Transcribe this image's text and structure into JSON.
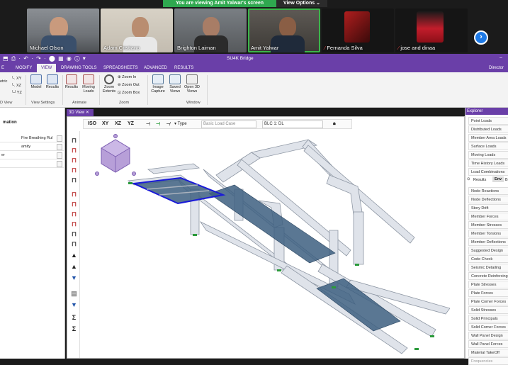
{
  "zoom": {
    "share_notice": "You are viewing Amit Yalwar's screen",
    "view_options": "View Options ⌄"
  },
  "participants": [
    {
      "name": "Michael Olson"
    },
    {
      "name": "Adam Cristiano"
    },
    {
      "name": "Brighton Laiman"
    },
    {
      "name": "Amit Yalwar"
    },
    {
      "name": "Fernanda Silva"
    },
    {
      "name": "jose and dinaa"
    }
  ],
  "app": {
    "title": "SU4K Bridge",
    "user": "Director"
  },
  "ribbon_tabs": [
    "MODIFY",
    "VIEW",
    "DRAWING TOOLS",
    "SPREADSHEETS",
    "ADVANCED",
    "RESULTS"
  ],
  "ribbon": {
    "view_settings": {
      "model": "Model",
      "results": "Results",
      "group": "View Settings",
      "xy": "XY",
      "xz": "XZ",
      "yz": "YZ",
      "etric": "etric",
      "d_view": "D View"
    },
    "animate": {
      "results": "Results",
      "moving_loads": "Moving Loads",
      "group": "Animate"
    },
    "zoom": {
      "extents": "Zoom Extents",
      "in": "Zoom In",
      "out": "Zoom Out",
      "box": "Zoom Box",
      "group": "Zoom"
    },
    "window": {
      "image_capture": "Image Capture",
      "saved_views": "Saved Views",
      "open_3d": "Open 3D Views",
      "group": "Window"
    }
  },
  "left_panel": {
    "header": "mation",
    "rows": [
      {
        "label": "",
        "value": "Fire Breathing Rul"
      },
      {
        "label": "",
        "value": "amity"
      },
      {
        "label": "er",
        "value": ""
      },
      {
        "label": "",
        "value": ""
      }
    ]
  },
  "view": {
    "tab": "3D View",
    "toolbar": {
      "iso": "ISO",
      "xy": "XY",
      "xz": "XZ",
      "yz": "YZ",
      "type": "Type",
      "load_case": "Basic Load Case",
      "case_value": "BLC 1: DL"
    }
  },
  "explorer": {
    "title": "Explorer",
    "items_top": [
      "Point Loads",
      "Distributed Loads",
      "Member Area Loads",
      "Surface Loads",
      "Moving Loads",
      "Time History Loads",
      "Load Combinations"
    ],
    "tabs": {
      "results": "Results",
      "env": "Env",
      "b": "B"
    },
    "items_bottom": [
      "Node Reactions",
      "Node Deflections",
      "Story Drift",
      "Member Forces",
      "Member Stresses",
      "Member Torsions",
      "Member Deflections",
      "Suggested Design",
      "Code Check",
      "Seismic Detailing",
      "Concrete Reinforcing",
      "Plate Stresses",
      "Plate Forces",
      "Plate Corner Forces",
      "Solid Stresses",
      "Solid Principals",
      "Solid Corner Forces",
      "Wall Panel Design",
      "Wall Panel Forces",
      "Material TakeOff",
      "Frequencies"
    ]
  },
  "colors": {
    "brand_purple": "#6a3fa8",
    "zoom_green": "#2fa84f",
    "deck_fill": "#3d5f80",
    "selection_blue": "#1a1ad8",
    "support_green": "#2a9a3a"
  }
}
